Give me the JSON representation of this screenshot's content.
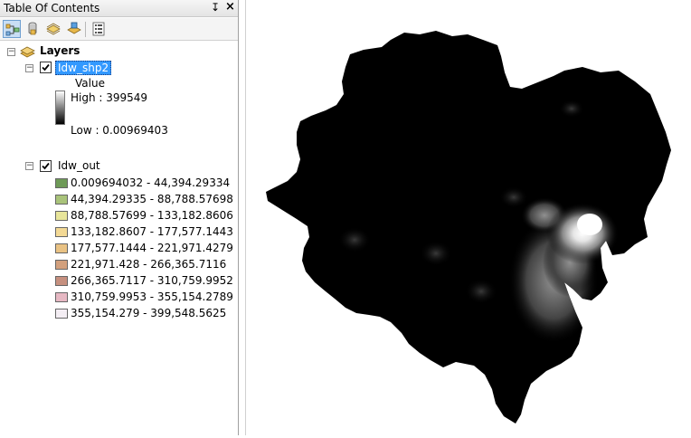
{
  "window": {
    "title": "Table Of Contents",
    "pin_glyph": "↧",
    "close_glyph": "×"
  },
  "toolbar": {
    "buttons": [
      {
        "icon": "list-by-drawing-order-icon",
        "active": true
      },
      {
        "icon": "list-by-source-icon",
        "active": false
      },
      {
        "icon": "list-by-visibility-icon",
        "active": false
      },
      {
        "icon": "list-by-selection-icon",
        "active": false
      },
      {
        "icon": "options-icon",
        "active": false
      }
    ]
  },
  "tree": {
    "root": {
      "label": "Layers",
      "expanded": true
    },
    "layers": [
      {
        "name": "Idw_shp2",
        "checked": true,
        "selected": true,
        "legend": {
          "field": "Value",
          "high": "High : 399549",
          "low": "Low : 0.00969403"
        }
      },
      {
        "name": "Idw_out",
        "checked": true,
        "selected": false,
        "classes": [
          {
            "label": "0.009694032 - 44,394.29334",
            "color": "#6e9a57"
          },
          {
            "label": "44,394.29335 - 88,788.57698",
            "color": "#a9c37a"
          },
          {
            "label": "88,788.57699 - 133,182.8606",
            "color": "#e8e59a"
          },
          {
            "label": "133,182.8607 - 177,577.1443",
            "color": "#f3d995"
          },
          {
            "label": "177,577.1444 - 221,971.4279",
            "color": "#e9c284"
          },
          {
            "label": "221,971.428 - 266,365.7116",
            "color": "#d2a07d"
          },
          {
            "label": "266,365.7117 - 310,759.9952",
            "color": "#c6907f"
          },
          {
            "label": "310,759.9953 - 355,154.2789",
            "color": "#e6b8c3"
          },
          {
            "label": "355,154.279 - 399,548.5625",
            "color": "#f4eef4"
          }
        ]
      }
    ]
  },
  "map": {
    "background": "#ffffff",
    "raster_base_color": "#000000",
    "hotspot_color": "#ffffff"
  }
}
